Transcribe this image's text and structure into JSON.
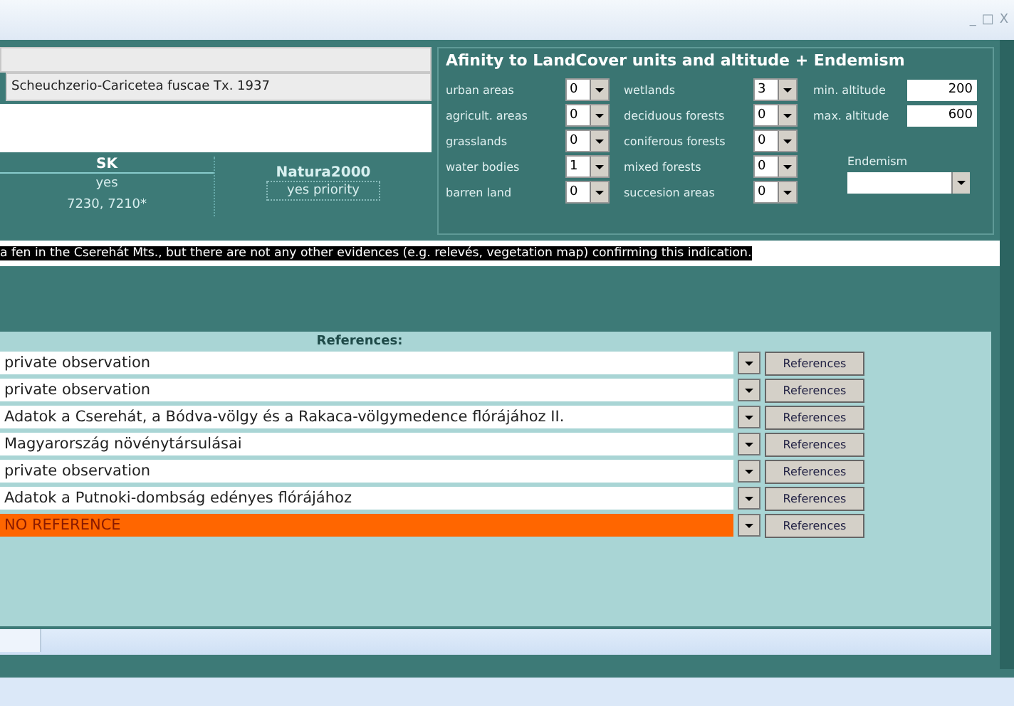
{
  "window": {
    "controls": [
      "_",
      "□",
      "X"
    ]
  },
  "syntaxon": {
    "name": "Scheuchzerio-Caricetea fuscae Tx. 1937"
  },
  "status_table": {
    "header": "SK",
    "values": [
      "yes",
      "7230, 7210*"
    ],
    "natura_label": "Natura2000",
    "natura_value": "yes priority"
  },
  "affinity": {
    "title": "Afinity  to LandCover units and altitude + Endemism",
    "left": [
      {
        "label": "urban areas",
        "value": "0"
      },
      {
        "label": "agricult. areas",
        "value": "0"
      },
      {
        "label": "grasslands",
        "value": "0"
      },
      {
        "label": "water bodies",
        "value": "1"
      },
      {
        "label": "barren land",
        "value": "0"
      }
    ],
    "middle": [
      {
        "label": "wetlands",
        "value": "3"
      },
      {
        "label": "deciduous forests",
        "value": "0"
      },
      {
        "label": "coniferous forests",
        "value": "0"
      },
      {
        "label": "mixed forests",
        "value": "0"
      },
      {
        "label": "succesion areas",
        "value": "0"
      }
    ],
    "altitude": [
      {
        "label": "min. altitude",
        "value": "200"
      },
      {
        "label": "max. altitude",
        "value": "600"
      }
    ],
    "endemism_label": "Endemism"
  },
  "note": {
    "text": "a fen in the Cserehát Mts., but there are not any other evidences (e.g. relevés, vegetation map) confirming this indication.",
    "selected": true
  },
  "references": {
    "title": "References:",
    "rows": [
      {
        "text": "private observation",
        "button": "References",
        "missing": false
      },
      {
        "text": "private observation",
        "button": "References",
        "missing": false
      },
      {
        "text": "Adatok a Cserehát, a Bódva-völgy és a Rakaca-völgymedence flórájához II.",
        "button": "References",
        "missing": false
      },
      {
        "text": "Magyarország növénytársulásai",
        "button": "References",
        "missing": false
      },
      {
        "text": "private observation",
        "button": "References",
        "missing": false
      },
      {
        "text": "Adatok a Putnoki-dombság edényes flórájához",
        "button": "References",
        "missing": false
      },
      {
        "text": "NO REFERENCE",
        "button": "References",
        "missing": true
      }
    ]
  }
}
